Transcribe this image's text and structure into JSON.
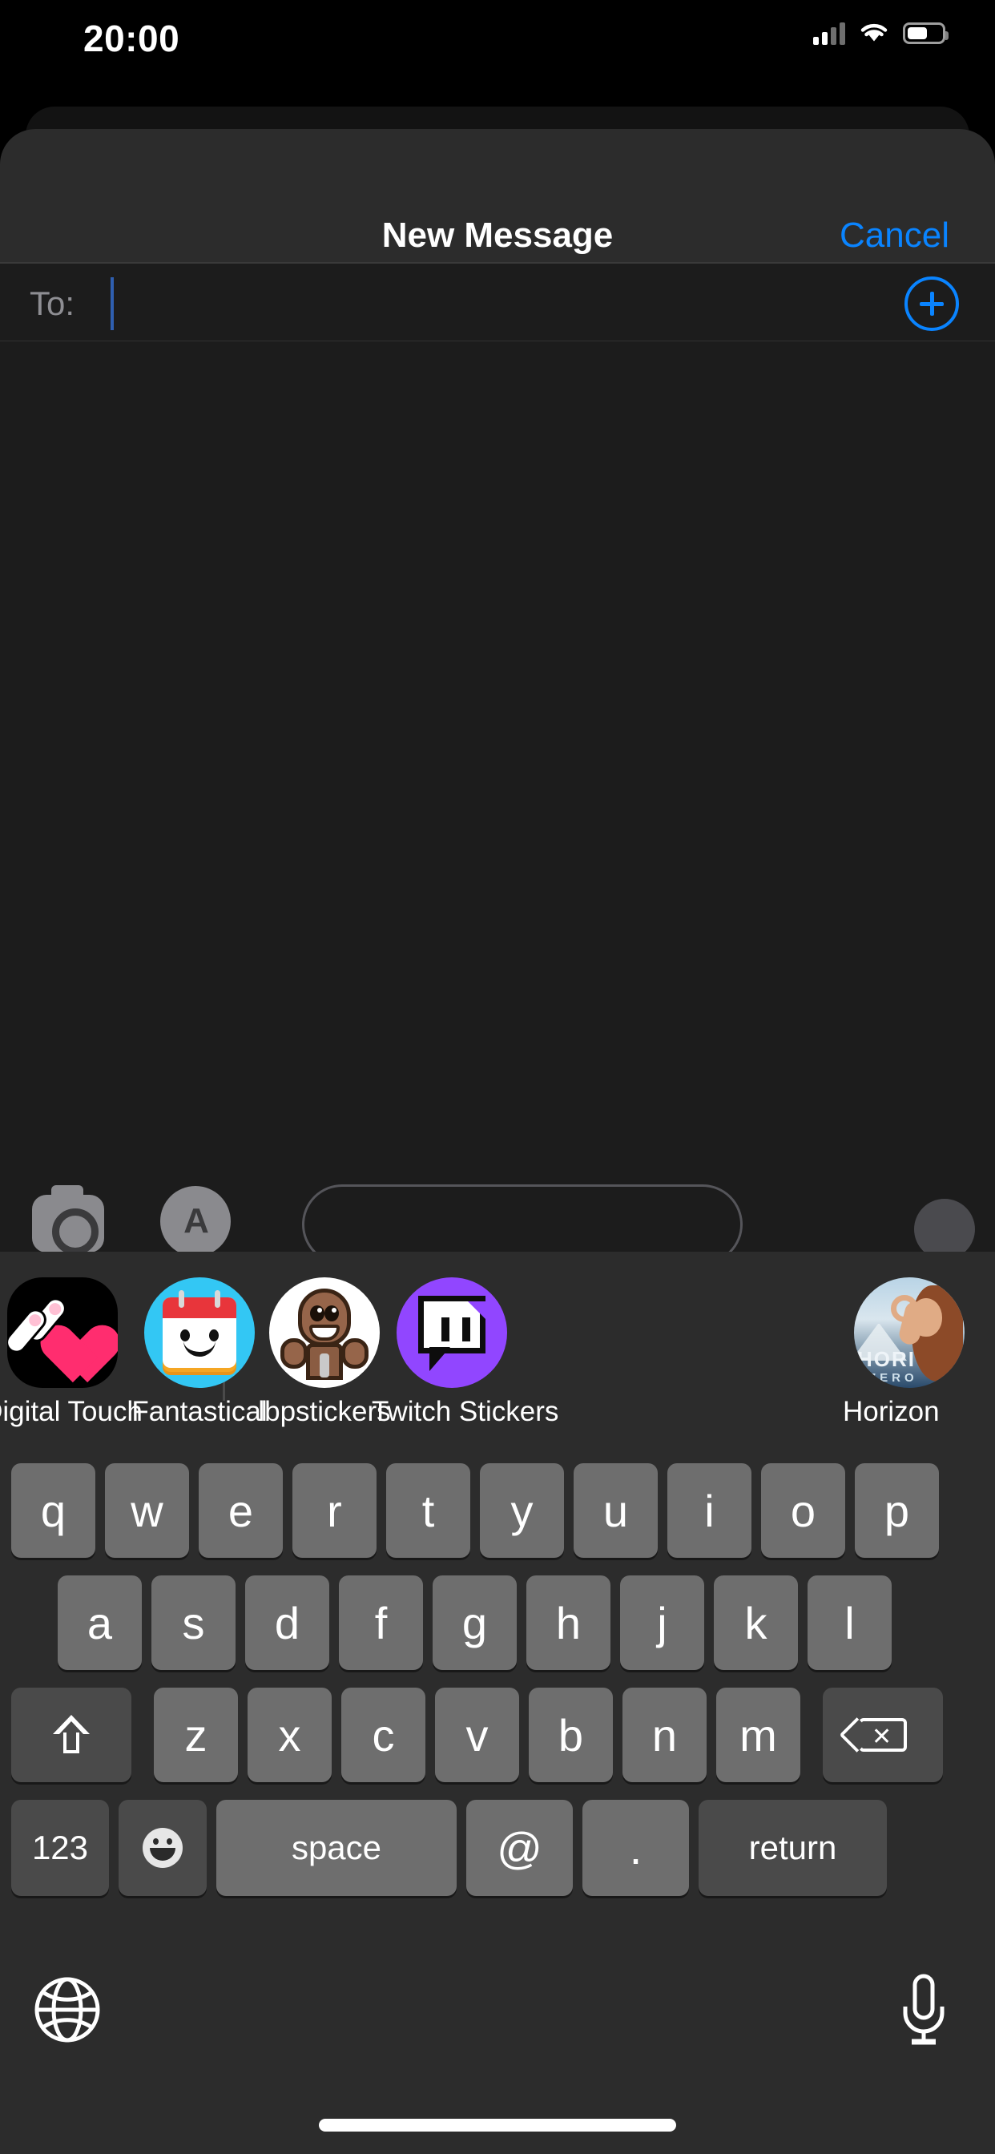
{
  "status_bar": {
    "time": "20:00",
    "signal_icon": "cellular-signal-icon",
    "signal_bars_filled": 2,
    "signal_bars_total": 4,
    "wifi_icon": "wifi-icon",
    "battery_icon": "battery-icon",
    "battery_level_percent": 50
  },
  "nav_bar": {
    "title": "New Message",
    "cancel_label": "Cancel"
  },
  "recipient_field": {
    "label": "To:",
    "value": "",
    "placeholder": "",
    "add_contact_icon": "plus-circle-icon"
  },
  "input_bar": {
    "camera_icon": "camera-icon",
    "appstore_icon": "app-store-icon",
    "appstore_glyph": "A",
    "message_placeholder": "",
    "send_audio_icon": "audio-record-icon"
  },
  "app_drawer": {
    "apps": [
      {
        "label": "Digital Touch",
        "icon": "digital-touch-icon"
      },
      {
        "label": "Fantastical",
        "icon": "fantastical-calendar-icon"
      },
      {
        "label": "lbpstickers",
        "icon": "sackboy-sticker-icon"
      },
      {
        "label": "Twitch Stickers",
        "icon": "twitch-glitch-icon"
      },
      {
        "label": "Horizon",
        "icon": "horizon-zero-dawn-icon"
      }
    ],
    "horizon_art": {
      "title": "HORI",
      "subtitle": "ZERO"
    }
  },
  "keyboard": {
    "layout": "email-qwerty",
    "row1": [
      "q",
      "w",
      "e",
      "r",
      "t",
      "y",
      "u",
      "i",
      "o",
      "p"
    ],
    "row2": [
      "a",
      "s",
      "d",
      "f",
      "g",
      "h",
      "j",
      "k",
      "l"
    ],
    "row3": [
      "z",
      "x",
      "c",
      "v",
      "b",
      "n",
      "m"
    ],
    "shift_icon": "shift-arrow-icon",
    "backspace_icon": "backspace-delete-icon",
    "numbers_label": "123",
    "emoji_icon": "emoji-smiley-icon",
    "space_label": "space",
    "at_label": "@",
    "period_label": ".",
    "return_label": "return",
    "globe_icon": "globe-language-icon",
    "dictation_icon": "microphone-icon"
  },
  "colors": {
    "accent_blue": "#0a84ff",
    "sheet_bg": "#1c1c1c",
    "nav_bg": "#2c2c2c",
    "key_light": "#6e6e6e",
    "key_dark": "#4a4a4a",
    "twitch_purple": "#9146ff",
    "fantastical_cyan": "#33c7f4",
    "digital_touch_pink": "#ff2d6f"
  },
  "home_indicator": {
    "visible": true
  }
}
